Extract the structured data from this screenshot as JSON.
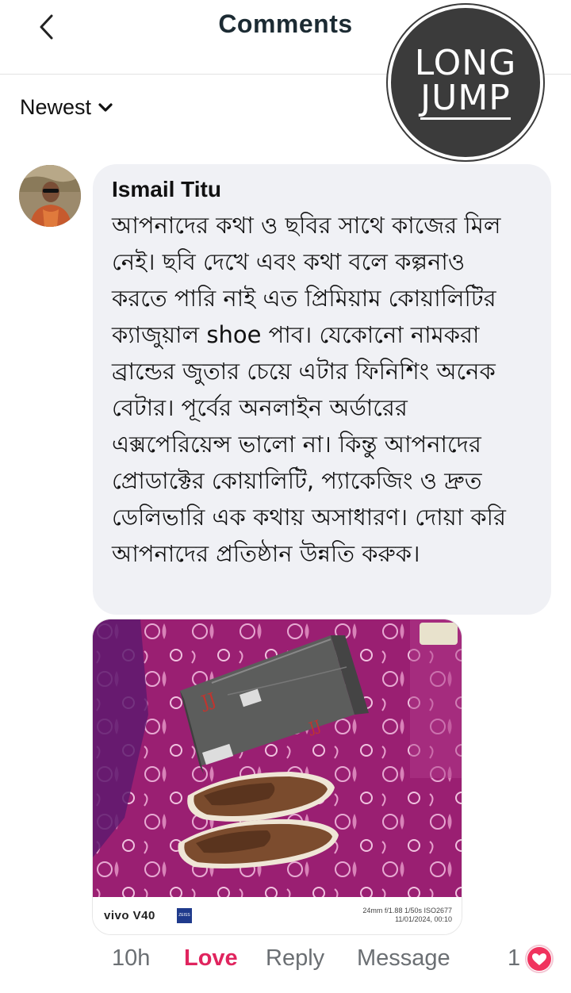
{
  "header": {
    "title": "Comments",
    "back_icon": "chevron-left-icon"
  },
  "watermark": {
    "line1": "LONG",
    "line2": "JUMP"
  },
  "sort": {
    "label": "Newest",
    "icon": "chevron-down-icon"
  },
  "comment": {
    "author": "Ismail Titu",
    "text": "আপনাদের কথা ও ছবির সাথে কাজের মিল নেই। ছবি দেখে এবং কথা বলে কল্পনাও করতে পারি নাই এত প্রিমিয়াম কোয়ালিটির ক্যাজুয়াল shoe পাব। যেকোনো নামকরা ব্রান্ডের জুতার  চেয়ে এটার ফিনিশিং অনেক বেটার। পূর্বের অনলাইন অর্ডারের এক্সপেরিয়েন্স ভালো না। কিন্তু আপনাদের প্রোডাক্টের কোয়ালিটি, প্যাকেজিং ও দ্রুত ডেলিভারি এক কথায় অসাধারণ। দোয়া করি আপনাদের প্রতিষ্ঠান উন্নতি করুক।",
    "photo": {
      "camera_brand": "vivo V40",
      "camera_info_line1": "24mm  f/1.88  1/50s  ISO2677",
      "camera_info_line2": "11/01/2024, 00:10"
    },
    "actions": {
      "time": "10h",
      "love": "Love",
      "reply": "Reply",
      "message": "Message",
      "reaction_count": "1"
    }
  },
  "colors": {
    "love": "#e0245e",
    "bubble": "#f0f1f5",
    "title": "#1c2b33"
  }
}
